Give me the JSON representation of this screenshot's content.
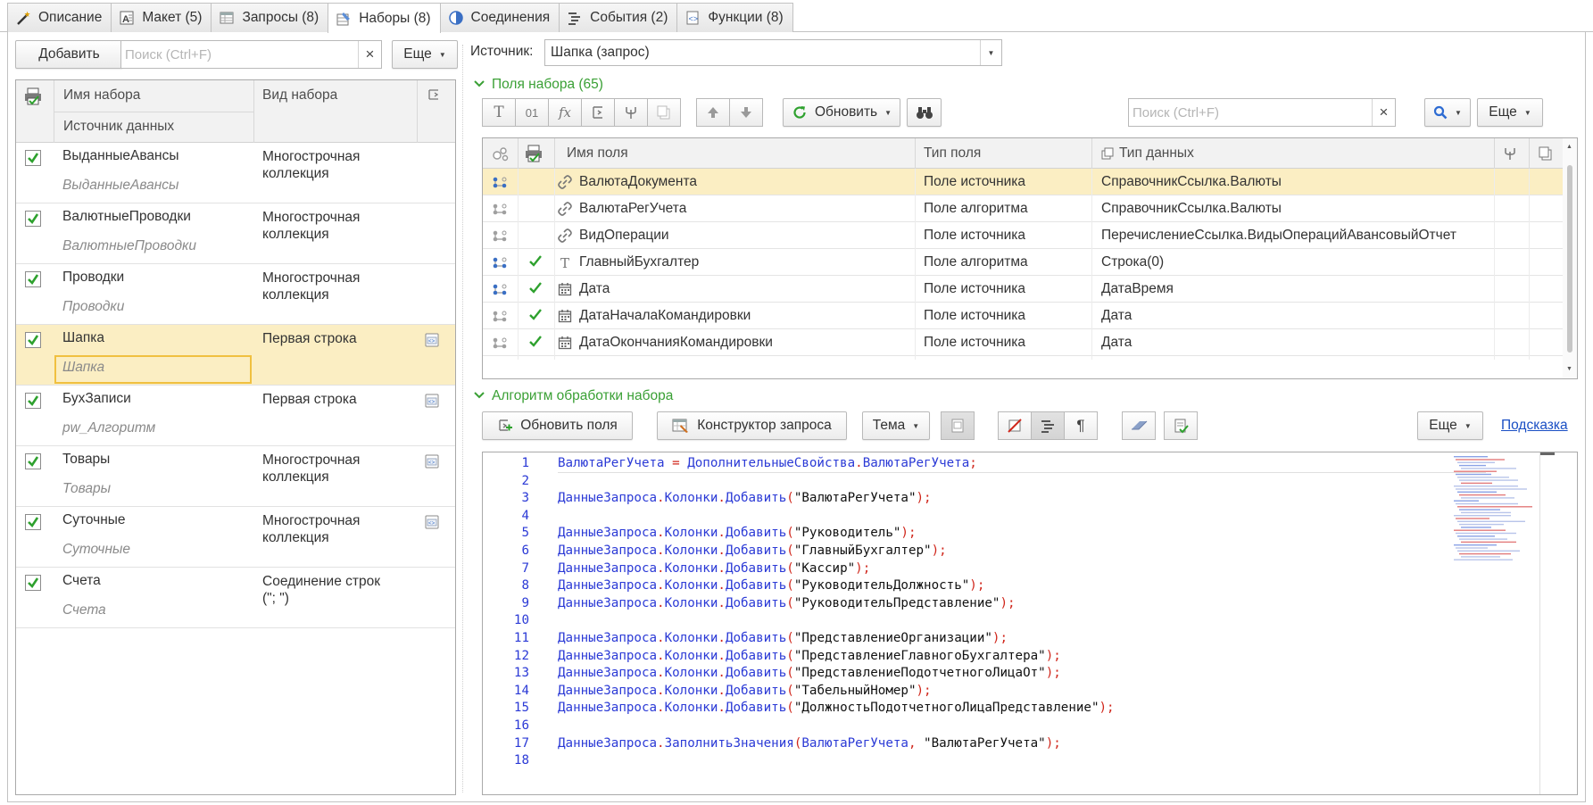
{
  "tabs": [
    {
      "label": "Описание",
      "icon": "wand-icon",
      "active": false
    },
    {
      "label": "Макет (5)",
      "icon": "layout-icon",
      "active": false
    },
    {
      "label": "Запросы (8)",
      "icon": "query-table-icon",
      "active": false
    },
    {
      "label": "Наборы (8)",
      "icon": "datasets-icon",
      "active": true
    },
    {
      "label": "Соединения",
      "icon": "pie-connections-icon",
      "active": false
    },
    {
      "label": "События (2)",
      "icon": "events-icon",
      "active": false
    },
    {
      "label": "Функции (8)",
      "icon": "functions-icon",
      "active": false
    }
  ],
  "left": {
    "add_label": "Добавить",
    "search_placeholder": "Поиск (Ctrl+F)",
    "more_label": "Еще",
    "columns": {
      "name": "Имя набора",
      "source": "Источник данных",
      "kind": "Вид набора"
    },
    "rows": [
      {
        "name": "ВыданныеАвансы",
        "source": "ВыданныеАвансы",
        "kind": "Многострочная коллекция",
        "checked": true,
        "has_icon": false,
        "selected": false
      },
      {
        "name": "ВалютныеПроводки",
        "source": "ВалютныеПроводки",
        "kind": "Многострочная коллекция",
        "checked": true,
        "has_icon": false,
        "selected": false
      },
      {
        "name": "Проводки",
        "source": "Проводки",
        "kind": "Многострочная коллекция",
        "checked": true,
        "has_icon": false,
        "selected": false
      },
      {
        "name": "Шапка",
        "source": "Шапка",
        "kind": "Первая строка",
        "checked": true,
        "has_icon": true,
        "selected": true
      },
      {
        "name": "БухЗаписи",
        "source": "pw_Алгоритм",
        "kind": "Первая строка",
        "checked": true,
        "has_icon": true,
        "selected": false
      },
      {
        "name": "Товары",
        "source": "Товары",
        "kind": "Многострочная коллекция",
        "checked": true,
        "has_icon": true,
        "selected": false
      },
      {
        "name": "Суточные",
        "source": "Суточные",
        "kind": "Многострочная коллекция",
        "checked": true,
        "has_icon": true,
        "selected": false
      },
      {
        "name": "Счета",
        "source": "Счета",
        "kind": "Соединение строк (\"; \")",
        "checked": true,
        "has_icon": false,
        "selected": false
      }
    ]
  },
  "right": {
    "source_label": "Источник:",
    "source_value": "Шапка (запрос)",
    "fields_section": "Поля набора (65)",
    "refresh_label": "Обновить",
    "search_placeholder": "Поиск (Ctrl+F)",
    "more_label": "Еще",
    "field_columns": {
      "name": "Имя поля",
      "type": "Тип поля",
      "datatype": "Тип данных"
    },
    "fields": [
      {
        "name": "ВалютаДокумента",
        "type": "Поле источника",
        "datatype": "СправочникСсылка.Валюты",
        "checked": false,
        "kind_icon": "link-icon",
        "active": true,
        "selected": true
      },
      {
        "name": "ВалютаРегУчета",
        "type": "Поле алгоритма",
        "datatype": "СправочникСсылка.Валюты",
        "checked": false,
        "kind_icon": "link-icon",
        "active": false,
        "selected": false
      },
      {
        "name": "ВидОперации",
        "type": "Поле источника",
        "datatype": "ПеречислениеСсылка.ВидыОперацийАвансовыйОтчет",
        "checked": false,
        "kind_icon": "link-icon",
        "active": false,
        "selected": false
      },
      {
        "name": "ГлавныйБухгалтер",
        "type": "Поле алгоритма",
        "datatype": "Строка(0)",
        "checked": true,
        "kind_icon": "text-icon",
        "active": true,
        "selected": false
      },
      {
        "name": "Дата",
        "type": "Поле источника",
        "datatype": "ДатаВремя",
        "checked": true,
        "kind_icon": "calendar-icon",
        "active": true,
        "selected": false
      },
      {
        "name": "ДатаНачалаКомандировки",
        "type": "Поле источника",
        "datatype": "Дата",
        "checked": true,
        "kind_icon": "calendar-icon",
        "active": false,
        "selected": false
      },
      {
        "name": "ДатаОкончанияКомандировки",
        "type": "Поле источника",
        "datatype": "Дата",
        "checked": true,
        "kind_icon": "calendar-icon",
        "active": false,
        "selected": false
      }
    ],
    "algo_section": "Алгоритм обработки набора",
    "update_fields_label": "Обновить поля",
    "query_builder_label": "Конструктор запроса",
    "theme_label": "Тема",
    "more2_label": "Еще",
    "hint_label": "Подсказка",
    "toolbar_text": {
      "t": "T",
      "num": "01",
      "fx": "fx"
    }
  },
  "code_lines": [
    [
      [
        "k",
        "ВалютаРегУчета "
      ],
      [
        "p",
        "= "
      ],
      [
        "k",
        "ДополнительныеСвойства"
      ],
      [
        "p",
        "."
      ],
      [
        "k",
        "ВалютаРегУчета"
      ],
      [
        "p",
        ";"
      ]
    ],
    [],
    [
      [
        "k",
        "ДанныеЗапроса"
      ],
      [
        "p",
        "."
      ],
      [
        "k",
        "Колонки"
      ],
      [
        "p",
        "."
      ],
      [
        "k",
        "Добавить"
      ],
      [
        "p",
        "("
      ],
      [
        "s",
        "\"ВалютаРегУчета\""
      ],
      [
        "p",
        ");"
      ]
    ],
    [],
    [
      [
        "k",
        "ДанныеЗапроса"
      ],
      [
        "p",
        "."
      ],
      [
        "k",
        "Колонки"
      ],
      [
        "p",
        "."
      ],
      [
        "k",
        "Добавить"
      ],
      [
        "p",
        "("
      ],
      [
        "s",
        "\"Руководитель\""
      ],
      [
        "p",
        ");"
      ]
    ],
    [
      [
        "k",
        "ДанныеЗапроса"
      ],
      [
        "p",
        "."
      ],
      [
        "k",
        "Колонки"
      ],
      [
        "p",
        "."
      ],
      [
        "k",
        "Добавить"
      ],
      [
        "p",
        "("
      ],
      [
        "s",
        "\"ГлавныйБухгалтер\""
      ],
      [
        "p",
        ");"
      ]
    ],
    [
      [
        "k",
        "ДанныеЗапроса"
      ],
      [
        "p",
        "."
      ],
      [
        "k",
        "Колонки"
      ],
      [
        "p",
        "."
      ],
      [
        "k",
        "Добавить"
      ],
      [
        "p",
        "("
      ],
      [
        "s",
        "\"Кассир\""
      ],
      [
        "p",
        ");"
      ]
    ],
    [
      [
        "k",
        "ДанныеЗапроса"
      ],
      [
        "p",
        "."
      ],
      [
        "k",
        "Колонки"
      ],
      [
        "p",
        "."
      ],
      [
        "k",
        "Добавить"
      ],
      [
        "p",
        "("
      ],
      [
        "s",
        "\"РуководительДолжность\""
      ],
      [
        "p",
        ");"
      ]
    ],
    [
      [
        "k",
        "ДанныеЗапроса"
      ],
      [
        "p",
        "."
      ],
      [
        "k",
        "Колонки"
      ],
      [
        "p",
        "."
      ],
      [
        "k",
        "Добавить"
      ],
      [
        "p",
        "("
      ],
      [
        "s",
        "\"РуководительПредставление\""
      ],
      [
        "p",
        ");"
      ]
    ],
    [],
    [
      [
        "k",
        "ДанныеЗапроса"
      ],
      [
        "p",
        "."
      ],
      [
        "k",
        "Колонки"
      ],
      [
        "p",
        "."
      ],
      [
        "k",
        "Добавить"
      ],
      [
        "p",
        "("
      ],
      [
        "s",
        "\"ПредставлениеОрганизации\""
      ],
      [
        "p",
        ");"
      ]
    ],
    [
      [
        "k",
        "ДанныеЗапроса"
      ],
      [
        "p",
        "."
      ],
      [
        "k",
        "Колонки"
      ],
      [
        "p",
        "."
      ],
      [
        "k",
        "Добавить"
      ],
      [
        "p",
        "("
      ],
      [
        "s",
        "\"ПредставлениеГлавногоБухгалтера\""
      ],
      [
        "p",
        ");"
      ]
    ],
    [
      [
        "k",
        "ДанныеЗапроса"
      ],
      [
        "p",
        "."
      ],
      [
        "k",
        "Колонки"
      ],
      [
        "p",
        "."
      ],
      [
        "k",
        "Добавить"
      ],
      [
        "p",
        "("
      ],
      [
        "s",
        "\"ПредставлениеПодотчетногоЛицаОт\""
      ],
      [
        "p",
        ");"
      ]
    ],
    [
      [
        "k",
        "ДанныеЗапроса"
      ],
      [
        "p",
        "."
      ],
      [
        "k",
        "Колонки"
      ],
      [
        "p",
        "."
      ],
      [
        "k",
        "Добавить"
      ],
      [
        "p",
        "("
      ],
      [
        "s",
        "\"ТабельныйНомер\""
      ],
      [
        "p",
        ");"
      ]
    ],
    [
      [
        "k",
        "ДанныеЗапроса"
      ],
      [
        "p",
        "."
      ],
      [
        "k",
        "Колонки"
      ],
      [
        "p",
        "."
      ],
      [
        "k",
        "Добавить"
      ],
      [
        "p",
        "("
      ],
      [
        "s",
        "\"ДолжностьПодотчетногоЛицаПредставление\""
      ],
      [
        "p",
        ");"
      ]
    ],
    [],
    [
      [
        "k",
        "ДанныеЗапроса"
      ],
      [
        "p",
        "."
      ],
      [
        "k",
        "ЗаполнитьЗначения"
      ],
      [
        "p",
        "("
      ],
      [
        "k",
        "ВалютаРегУчета"
      ],
      [
        "p",
        ", "
      ],
      [
        "s",
        "\"ВалютаРегУчета\""
      ],
      [
        "p",
        ");"
      ]
    ],
    []
  ],
  "colors": {
    "accent_green": "#3aa035",
    "selection": "#fbeec3",
    "keyword_blue": "#2b3ad6",
    "punct_red": "#d0261b",
    "link_blue": "#1a4fc4"
  }
}
